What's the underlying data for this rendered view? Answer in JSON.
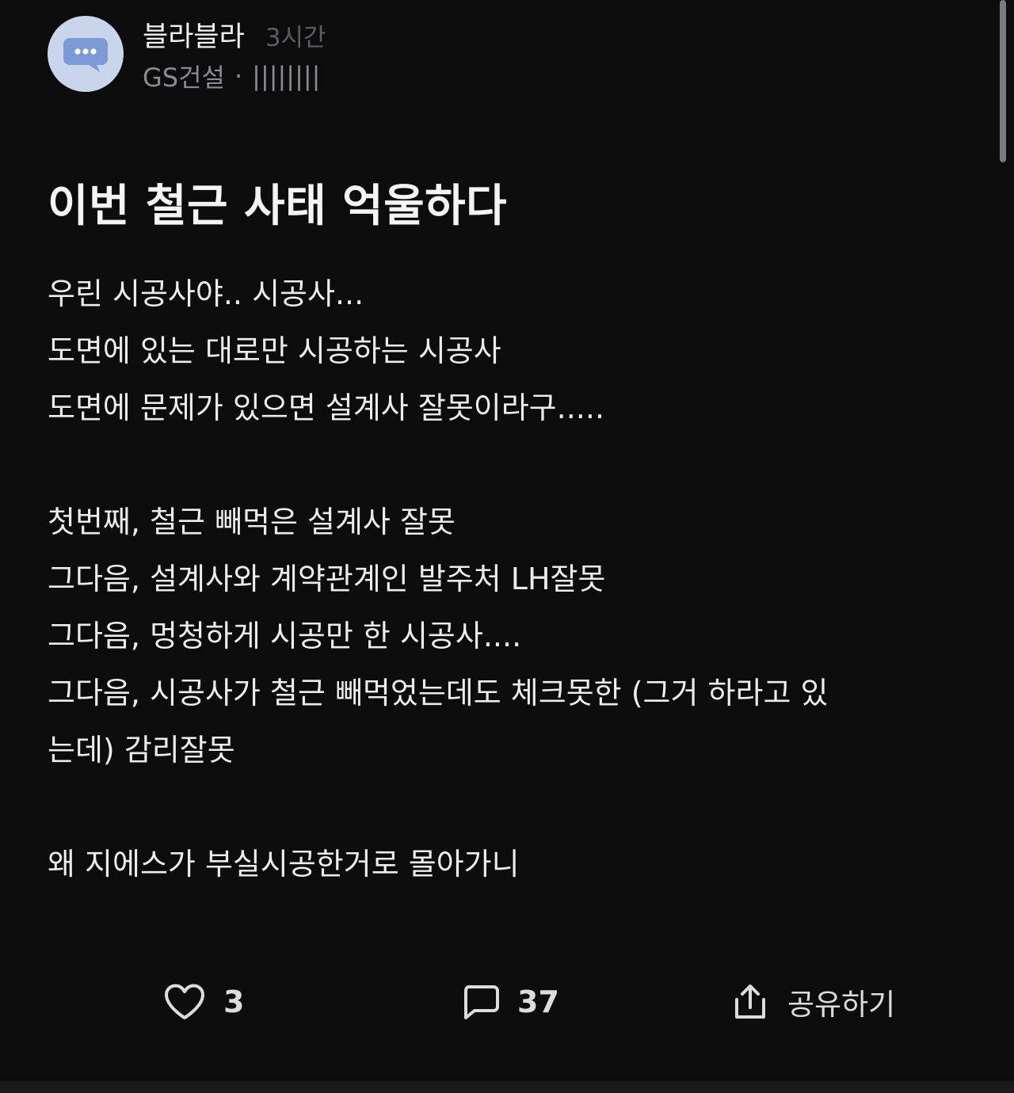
{
  "post": {
    "author": "블라블라",
    "time_ago": "3시간",
    "company": "GS건설",
    "separator": "·",
    "masked_tag": "||||||||",
    "title": "이번 철근 사태 억울하다",
    "body_paragraphs": [
      {
        "lines": [
          "우린 시공사야.. 시공사...",
          "도면에 있는 대로만 시공하는 시공사",
          "도면에 문제가 있으면 설계사 잘못이라구....."
        ]
      },
      {
        "lines": [
          "첫번째, 철근 빼먹은 설계사 잘못",
          "그다음, 설계사와 계약관계인 발주처 LH잘못",
          "그다음, 멍청하게 시공만 한 시공사....",
          "그다음, 시공사가 철근 빼먹었는데도 체크못한 (그거 하라고 있",
          "는데) 감리잘못"
        ]
      },
      {
        "lines": [
          "왜 지에스가 부실시공한거로 몰아가니"
        ]
      }
    ]
  },
  "actions": {
    "like_count": "3",
    "comment_count": "37",
    "share_label": "공유하기"
  },
  "icons": {
    "avatar": "chat-bubble-icon",
    "like": "heart-icon",
    "comment": "comment-icon",
    "share": "share-icon"
  },
  "colors": {
    "background": "#0c0c0d",
    "avatar_bg": "#c8d5ea",
    "avatar_bubble": "#7c9bd6",
    "text_primary": "#f2f2f2",
    "text_muted": "#8a8a8f",
    "text_faint": "#5d5d61"
  }
}
